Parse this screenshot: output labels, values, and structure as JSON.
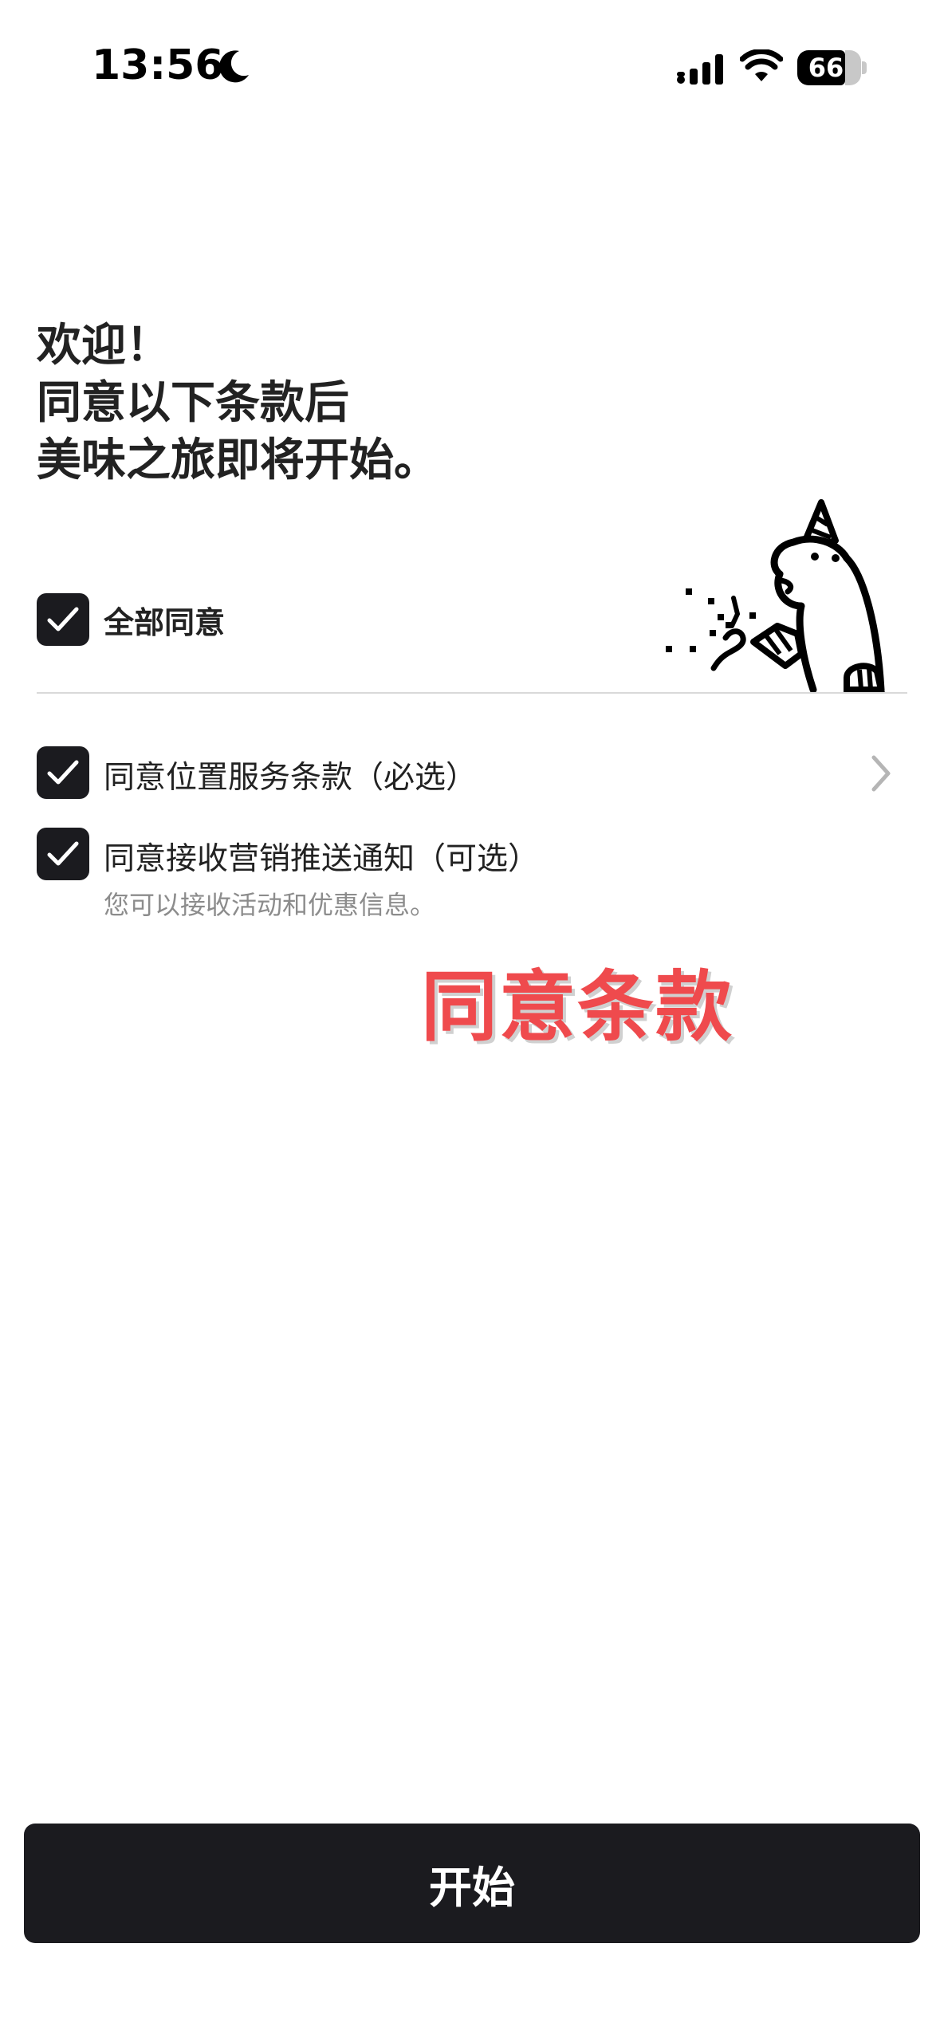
{
  "status_bar": {
    "time": "13:56",
    "battery": "66",
    "battery_level_percent": 66
  },
  "welcome": {
    "line1": "欢迎！",
    "line2": "同意以下条款后",
    "line3": "美味之旅即将开始。"
  },
  "agree_all": {
    "label": "全部同意",
    "checked": true
  },
  "terms": [
    {
      "label": "同意位置服务条款（必选）",
      "checked": true
    },
    {
      "label": "同意接收营销推送通知（可选）",
      "checked": true,
      "sub": "您可以接收活动和优惠信息。"
    }
  ],
  "overlay_caption": "同意条款",
  "start_button": {
    "label": "开始"
  },
  "colors": {
    "accent_dark": "#1b1b1f",
    "caption_red": "#ef4a4d"
  },
  "icons": {
    "moon": "moon-icon",
    "signal": "cellular-signal-icon",
    "wifi": "wifi-icon",
    "check": "check-icon",
    "chevron": "chevron-right-icon"
  }
}
